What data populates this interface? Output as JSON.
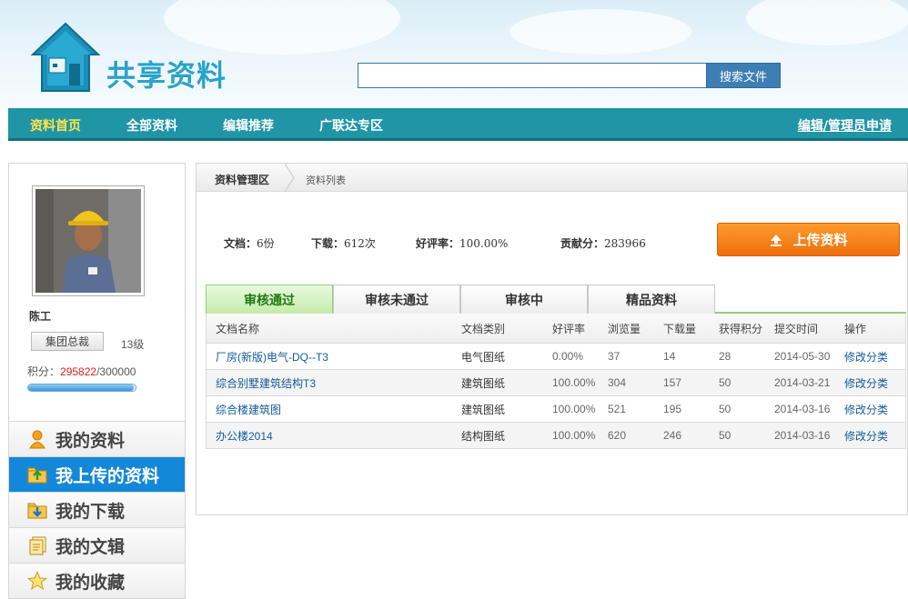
{
  "header": {
    "logo_text": "共享资料",
    "search_placeholder": "",
    "search_button": "搜索文件"
  },
  "nav": {
    "items": [
      "资料首页",
      "全部资料",
      "编辑推荐",
      "广联达专区"
    ],
    "right_link": "编辑/管理员申请"
  },
  "sidebar": {
    "user_name": "陈工",
    "rank": "集团总裁",
    "level": "13级",
    "points_label": "积分：",
    "points_current": "295822",
    "points_total": "/300000",
    "points_progress": 0.986,
    "menu": [
      {
        "label": "我的资料",
        "icon": "user-icon"
      },
      {
        "label": "我上传的资料",
        "icon": "upload-folder-icon"
      },
      {
        "label": "我的下载",
        "icon": "download-folder-icon"
      },
      {
        "label": "我的文辑",
        "icon": "document-stack-icon"
      },
      {
        "label": "我的收藏",
        "icon": "star-icon"
      }
    ]
  },
  "main": {
    "breadcrumb": [
      "资料管理区",
      "资料列表"
    ],
    "stats": [
      {
        "label": "文档：",
        "value": "6份"
      },
      {
        "label": "下载：",
        "value": "612次"
      },
      {
        "label": "好评率：",
        "value": "100.00%"
      },
      {
        "label": "贡献分：",
        "value": "283966"
      }
    ],
    "upload_button": "上传资料",
    "tabs": [
      "审核通过",
      "审核未通过",
      "审核中",
      "精品资料"
    ],
    "table": {
      "headers": [
        "文档名称",
        "文档类别",
        "好评率",
        "浏览量",
        "下载量",
        "获得积分",
        "提交时间",
        "操作"
      ],
      "rows": [
        [
          "厂房(新版)电气-DQ--T3",
          "电气图纸",
          "0.00%",
          "37",
          "14",
          "28",
          "2014-05-30",
          "修改分类"
        ],
        [
          "综合别墅建筑结构T3",
          "建筑图纸",
          "100.00%",
          "304",
          "157",
          "50",
          "2014-03-21",
          "修改分类"
        ],
        [
          "综合楼建筑图",
          "建筑图纸",
          "100.00%",
          "521",
          "195",
          "50",
          "2014-03-16",
          "修改分类"
        ],
        [
          "办公楼2014",
          "结构图纸",
          "100.00%",
          "620",
          "246",
          "50",
          "2014-03-16",
          "修改分类"
        ]
      ]
    }
  },
  "colors": {
    "nav_bg": "#1f95a6",
    "nav_active": "#ffe44a",
    "accent_blue": "#1488d8",
    "upload_orange": "#ee6f0c",
    "tab_green": "#8fd27a",
    "link_blue": "#135a9a",
    "points_red": "#d8221d"
  }
}
